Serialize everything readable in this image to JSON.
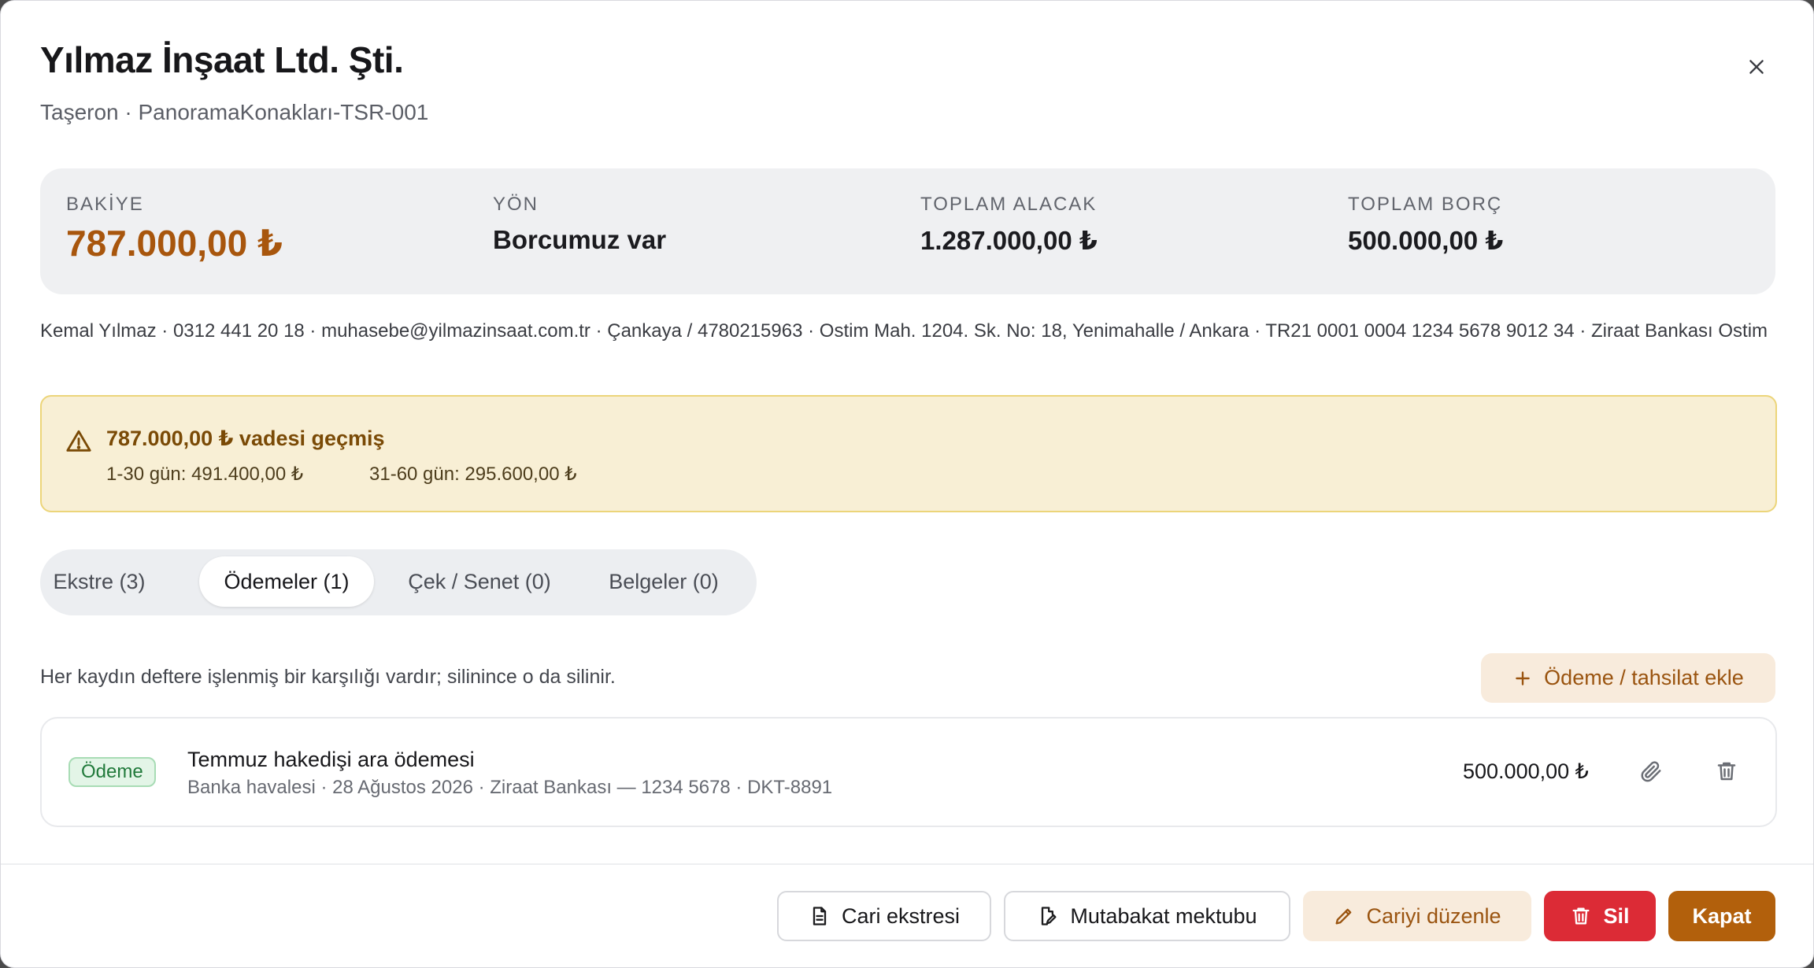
{
  "header": {
    "title": "Yılmaz İnşaat Ltd. Şti.",
    "subtitle": "Taşeron · PanoramaKonakları-TSR-001",
    "close_icon": "close-icon"
  },
  "summary": {
    "balance_label": "BAKİYE",
    "balance_value": "787.000,00 ₺",
    "direction_label": "YÖN",
    "direction_value": "Borcumuz var",
    "credit_label": "TOPLAM ALACAK",
    "credit_value": "1.287.000,00 ₺",
    "debit_label": "TOPLAM BORÇ",
    "debit_value": "500.000,00 ₺"
  },
  "contact": {
    "line": "Kemal Yılmaz · 0312 441 20 18 · muhasebe@yilmazinsaat.com.tr · Çankaya / 4780215963 · Ostim Mah. 1204. Sk. No: 18, Yenimahalle / Ankara · TR21 0001 0004 1234 5678 9012 34 · Ziraat Bankası Ostim"
  },
  "alert": {
    "icon": "warning-icon",
    "title": "787.000,00 ₺ vadesi geçmiş",
    "bucket_1": "1-30 gün: 491.400,00 ₺",
    "bucket_2": "31-60 gün: 295.600,00 ₺"
  },
  "tabs": [
    {
      "label": "Ekstre (3)",
      "active": false
    },
    {
      "label": "Ödemeler (1)",
      "active": true
    },
    {
      "label": "Çek / Senet (0)",
      "active": false
    },
    {
      "label": "Belgeler (0)",
      "active": false
    }
  ],
  "payments": {
    "note": "Her kaydın deftere işlenmiş bir karşılığı vardır; silinince o da silinir.",
    "add_label": "Ödeme / tahsilat ekle",
    "rows": [
      {
        "badge": "Ödeme",
        "title": "Temmuz hakedişi ara ödemesi",
        "details": "Banka havalesi · 28 Ağustos 2026 · Ziraat Bankası — 1234 5678 · DKT-8891",
        "amount": "500.000,00 ₺"
      }
    ]
  },
  "footer": {
    "statement_label": "Cari ekstresi",
    "reconciliation_label": "Mutabakat mektubu",
    "edit_label": "Cariyi düzenle",
    "delete_label": "Sil",
    "close_label": "Kapat"
  },
  "colors": {
    "accent": "#b2600c",
    "danger": "#dc2b36",
    "warning_bg": "#f8efd5",
    "success": "#217a3b"
  }
}
